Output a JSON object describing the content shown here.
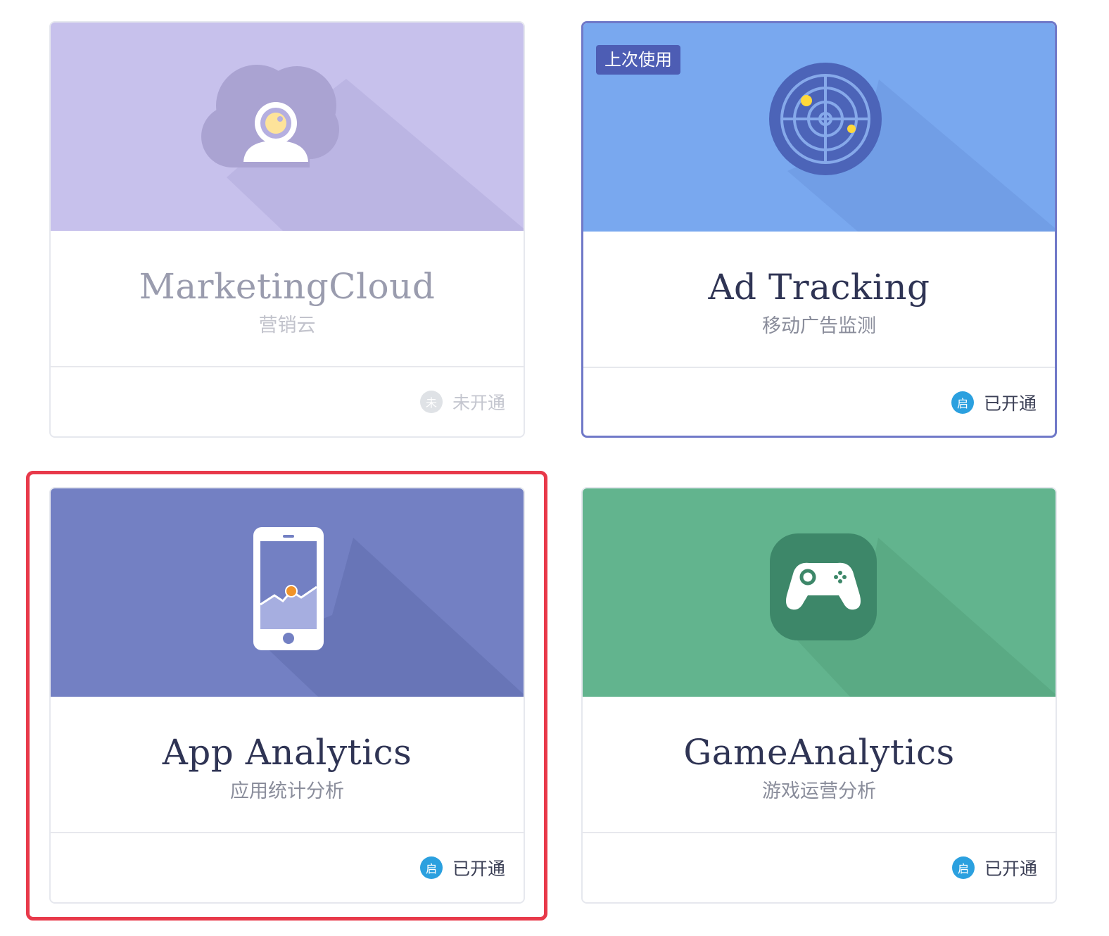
{
  "products": [
    {
      "name": "MarketingCloud",
      "subname": "营销云",
      "status_badge": "未",
      "status_label": "未开通",
      "enabled": false,
      "icon": "cloud-user-icon",
      "banner_color": "#c7c1ec"
    },
    {
      "name": "Ad Tracking",
      "subname": "移动广告监测",
      "status_badge": "启",
      "status_label": "已开通",
      "enabled": true,
      "last_used_tag": "上次使用",
      "icon": "radar-icon",
      "banner_color": "#79a8ef"
    },
    {
      "name": "App Analytics",
      "subname": "应用统计分析",
      "status_badge": "启",
      "status_label": "已开通",
      "enabled": true,
      "icon": "phone-chart-icon",
      "banner_color": "#7380c3",
      "highlighted": true
    },
    {
      "name": "GameAnalytics",
      "subname": "游戏运营分析",
      "status_badge": "启",
      "status_label": "已开通",
      "enabled": true,
      "icon": "gamepad-icon",
      "banner_color": "#62b48e"
    }
  ],
  "colors": {
    "highlight_border": "#e8394a",
    "active_border": "#7079c8",
    "status_badge": "#2ba0df"
  }
}
